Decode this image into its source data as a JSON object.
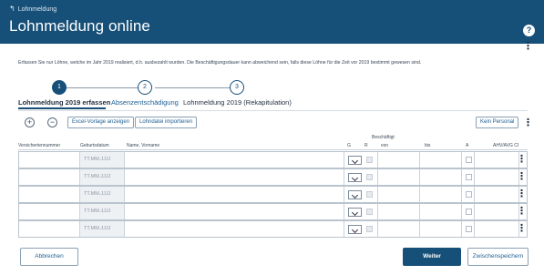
{
  "header": {
    "back_label": "Lohnmeldung",
    "title": "Lohnmeldung online",
    "help_icon": "?"
  },
  "info_text": "Erfassen Sie nur Löhne, welche im Jahr 2019 realisiert, d.h. ausbezahlt wurden. Die Beschäftigungsdauer kann abweichend sein, falls diese Löhne für die Zeit vor 2019 bestimmt gewesen sind.",
  "stepper": {
    "steps": [
      {
        "number": "1",
        "label": "Lohnmeldung 2019 erfassen",
        "state": "active"
      },
      {
        "number": "2",
        "label": "Absenzentschädigung",
        "state": "link"
      },
      {
        "number": "3",
        "label": "Lohnmeldung 2019 (Rekapitulation)",
        "state": "plain"
      }
    ]
  },
  "toolbar": {
    "add_symbol": "+",
    "remove_symbol": "−",
    "excel_template_label": "Excel-Vorlage anzeigen",
    "import_label": "Lohndatei importieren",
    "no_personnel_label": "Kein Personal"
  },
  "table": {
    "group_header": "Beschäftigt",
    "columns": {
      "ssn": "Versichertennummer",
      "birthdate": "Geburtsdatum",
      "name": "Name, Vorname",
      "gender": "G",
      "r": "R",
      "from": "von",
      "to": "bis",
      "a": "A",
      "ahv": "AHV/AVG CI"
    },
    "rows": [
      {
        "birthdate_placeholder": "TT.MM.JJJJ"
      },
      {
        "birthdate_placeholder": "TT.MM.JJJJ"
      },
      {
        "birthdate_placeholder": "TT.MM.JJJJ"
      },
      {
        "birthdate_placeholder": "TT.MM.JJJJ"
      },
      {
        "birthdate_placeholder": "TT.MM.JJJJ"
      }
    ]
  },
  "footer": {
    "cancel_label": "Abbrechen",
    "next_label": "Weiter",
    "save_label": "Zwischenspeichern"
  },
  "colors": {
    "brand": "#164f78",
    "link": "#1f5f93"
  },
  "icons": {
    "back": "return-arrow-icon",
    "help": "help-icon",
    "more": "kebab-menu-icon",
    "add": "plus-circle-icon",
    "remove": "minus-circle-icon",
    "dropdown": "chevron-down-icon"
  }
}
